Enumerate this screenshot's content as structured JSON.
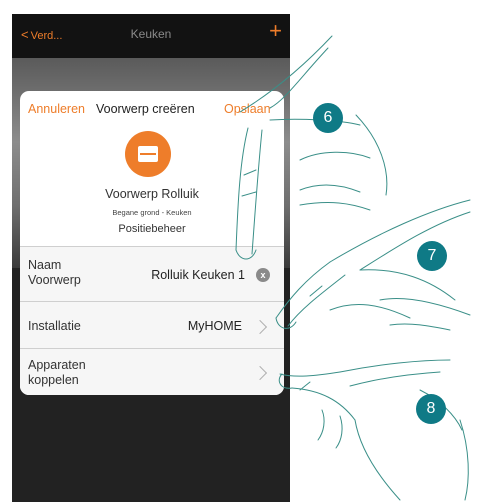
{
  "nav": {
    "back_label": "Verd...",
    "title": "Keuken",
    "add_symbol": "+"
  },
  "dialog": {
    "cancel_label": "Annuleren",
    "title": "Voorwerp creëren",
    "save_label": "Opslaan",
    "object_icon": "roller-shutter-icon",
    "object_name": "Voorwerp Rolluik",
    "object_location": "Begane grond - Keuken",
    "object_type": "Positiebeheer",
    "rows": [
      {
        "label_line1": "Naam",
        "label_line2": "Voorwerp",
        "value": "Rolluik Keuken 1",
        "action": "clear-icon",
        "action_symbol": "x"
      },
      {
        "label_line1": "Installatie",
        "label_line2": "",
        "value": "MyHOME",
        "action": "chevron-right-icon"
      },
      {
        "label_line1": "Apparaten",
        "label_line2": "koppelen",
        "value": "",
        "action": "chevron-right-icon"
      }
    ]
  },
  "steps": [
    "6",
    "7",
    "8"
  ],
  "colors": {
    "accent": "#ee7d2a",
    "step_badge": "#0f7a86",
    "nav_bg": "#121212"
  }
}
